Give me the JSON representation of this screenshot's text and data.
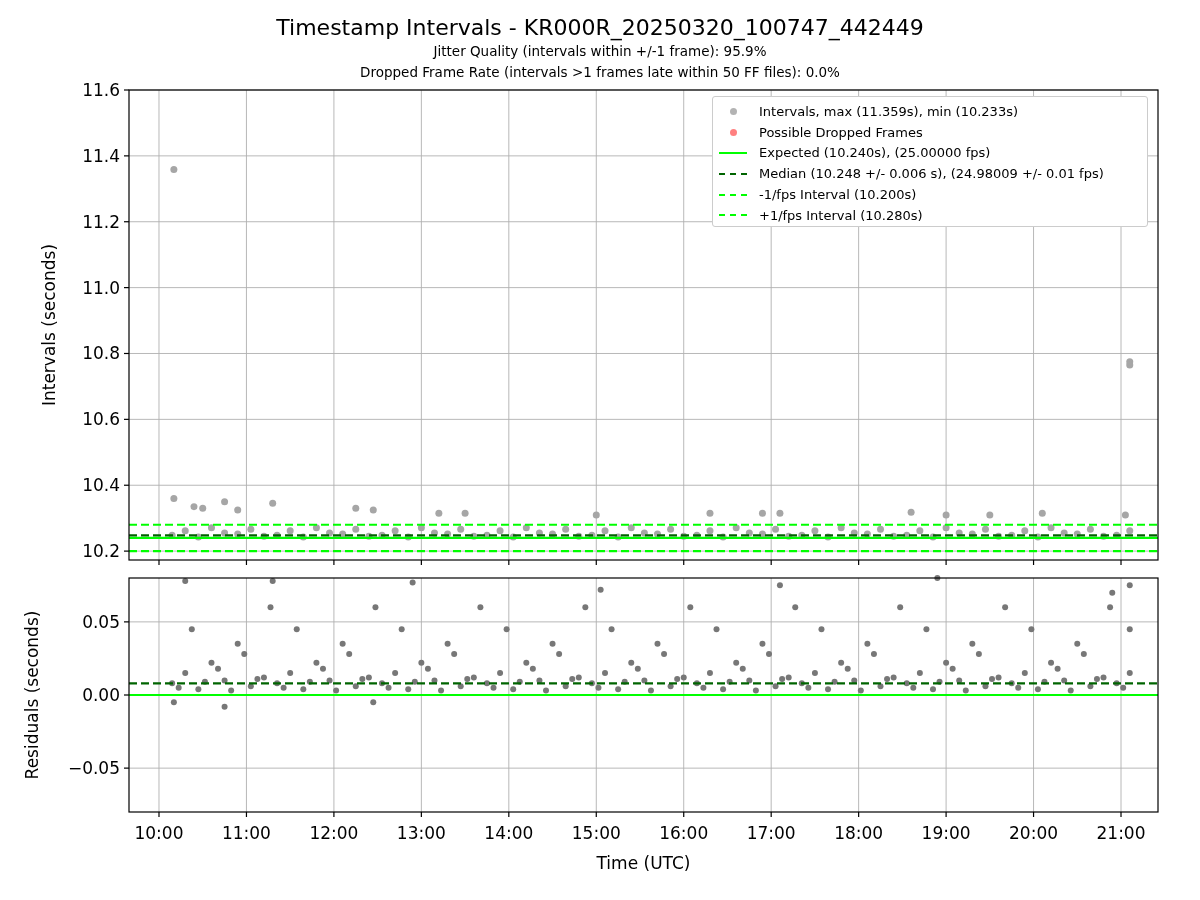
{
  "title": "Timestamp Intervals - KR000R_20250320_100747_442449",
  "subtitles": [
    "Jitter Quality (intervals within +/-1 frame): 95.9%",
    "Dropped Frame Rate (intervals >1 frames late within 50 FF files): 0.0%"
  ],
  "intervals_plot": {
    "legend": [
      {
        "label": "Intervals, max (11.359s), min (10.233s)",
        "kind": "point",
        "color": "#b3b3b3"
      },
      {
        "label": "Possible Dropped Frames",
        "kind": "point",
        "color": "#ff8080"
      },
      {
        "label": "Expected (10.240s), (25.00000 fps)",
        "kind": "solid",
        "color": "#00ff00"
      },
      {
        "label": "Median (10.248 +/- 0.006 s), (24.98009 +/- 0.01 fps)",
        "kind": "dashed",
        "color": "#006400"
      },
      {
        "label": "-1/fps Interval (10.200s)",
        "kind": "dashed",
        "color": "#00ff00"
      },
      {
        "label": "+1/fps Interval (10.280s)",
        "kind": "dashed",
        "color": "#00ff00"
      }
    ],
    "chart_data": {
      "type": "scatter",
      "ylabel": "Intervals (seconds)",
      "xlim": [
        9.657,
        21.423
      ],
      "ylim": [
        10.173,
        11.6
      ],
      "yticks": [
        {
          "value": 10.2,
          "label": "10.2"
        },
        {
          "value": 10.4,
          "label": "10.4"
        },
        {
          "value": 10.6,
          "label": "10.6"
        },
        {
          "value": 10.8,
          "label": "10.8"
        },
        {
          "value": 11.0,
          "label": "11.0"
        },
        {
          "value": 11.2,
          "label": "11.2"
        },
        {
          "value": 11.4,
          "label": "11.4"
        },
        {
          "value": 11.6,
          "label": "11.6"
        }
      ],
      "series": [
        {
          "color": "#a6a6a6",
          "x": [
            10.15,
            10.3,
            10.45,
            10.6,
            10.75,
            10.9,
            11.05,
            11.2,
            11.35,
            11.5,
            11.65,
            11.8,
            11.95,
            12.1,
            12.25,
            12.4,
            12.55,
            12.7,
            12.85,
            13,
            13.15,
            13.3,
            13.45,
            13.6,
            13.75,
            13.9,
            14.05,
            14.2,
            14.35,
            14.5,
            14.65,
            14.8,
            14.95,
            15.1,
            15.25,
            15.4,
            15.55,
            15.7,
            15.85,
            16,
            16.15,
            16.3,
            16.45,
            16.6,
            16.75,
            16.9,
            17.05,
            17.2,
            17.35,
            17.5,
            17.65,
            17.8,
            17.95,
            18.1,
            18.25,
            18.4,
            18.55,
            18.7,
            18.85,
            19,
            19.15,
            19.3,
            19.45,
            19.6,
            19.75,
            19.9,
            20.05,
            20.2,
            20.35,
            20.5,
            20.65,
            20.8,
            20.95,
            21.1,
            10.17,
            10.17,
            21.1,
            21.1,
            10.75,
            11.3,
            10.4,
            10.5,
            10.9,
            12.25,
            12.45,
            13.2,
            13.5,
            15.0,
            16.3,
            16.9,
            17.1,
            18.6,
            19.0,
            19.5,
            20.1,
            21.05
          ],
          "values": [
            10.248,
            10.262,
            10.243,
            10.271,
            10.255,
            10.252,
            10.266,
            10.245,
            10.248,
            10.262,
            10.243,
            10.271,
            10.255,
            10.252,
            10.266,
            10.245,
            10.248,
            10.262,
            10.243,
            10.271,
            10.255,
            10.252,
            10.266,
            10.245,
            10.248,
            10.262,
            10.243,
            10.271,
            10.255,
            10.252,
            10.266,
            10.245,
            10.248,
            10.262,
            10.243,
            10.271,
            10.255,
            10.252,
            10.266,
            10.245,
            10.248,
            10.262,
            10.243,
            10.271,
            10.255,
            10.252,
            10.266,
            10.245,
            10.248,
            10.262,
            10.243,
            10.271,
            10.255,
            10.252,
            10.266,
            10.245,
            10.248,
            10.262,
            10.243,
            10.271,
            10.255,
            10.252,
            10.266,
            10.245,
            10.248,
            10.262,
            10.243,
            10.271,
            10.255,
            10.252,
            10.266,
            10.245,
            10.248,
            10.262,
            11.359,
            10.36,
            10.775,
            10.765,
            10.35,
            10.345,
            10.335,
            10.33,
            10.325,
            10.33,
            10.325,
            10.315,
            10.315,
            10.31,
            10.315,
            10.315,
            10.315,
            10.318,
            10.31,
            10.31,
            10.315,
            10.31
          ]
        }
      ],
      "ref_lines": [
        {
          "axis": "y",
          "value": 10.24,
          "color": "#00ff00"
        },
        {
          "axis": "y",
          "value": 10.248,
          "color": "#006400"
        },
        {
          "axis": "y",
          "value": 10.2,
          "color": "#00ff00"
        },
        {
          "axis": "y",
          "value": 10.28,
          "color": "#00ff00"
        }
      ],
      "grid": true
    }
  },
  "residuals_plot": {
    "chart_data": {
      "type": "scatter",
      "xlabel": "Time (UTC)",
      "ylabel": "Residuals (seconds)",
      "xlim": [
        9.657,
        21.423
      ],
      "ylim": [
        -0.08,
        0.08
      ],
      "xticks": [
        {
          "value": 10,
          "label": "10:00"
        },
        {
          "value": 11,
          "label": "11:00"
        },
        {
          "value": 12,
          "label": "12:00"
        },
        {
          "value": 13,
          "label": "13:00"
        },
        {
          "value": 14,
          "label": "14:00"
        },
        {
          "value": 15,
          "label": "15:00"
        },
        {
          "value": 16,
          "label": "16:00"
        },
        {
          "value": 17,
          "label": "17:00"
        },
        {
          "value": 18,
          "label": "18:00"
        },
        {
          "value": 19,
          "label": "19:00"
        },
        {
          "value": 20,
          "label": "20:00"
        },
        {
          "value": 21,
          "label": "21:00"
        }
      ],
      "yticks": [
        {
          "value": -0.05,
          "label": "−0.05"
        },
        {
          "value": 0,
          "label": "0.00"
        },
        {
          "value": 0.05,
          "label": "0.05"
        }
      ],
      "series": [
        {
          "color": "#777777",
          "x": [
            10.15,
            10.3,
            10.45,
            10.6,
            10.75,
            10.9,
            11.05,
            11.2,
            11.35,
            11.5,
            11.65,
            11.8,
            11.95,
            12.1,
            12.25,
            12.4,
            12.55,
            12.7,
            12.85,
            13,
            13.15,
            13.3,
            13.45,
            13.6,
            13.75,
            13.9,
            14.05,
            14.2,
            14.35,
            14.5,
            14.65,
            14.8,
            14.95,
            15.1,
            15.25,
            15.4,
            15.55,
            15.7,
            15.85,
            16,
            16.15,
            16.3,
            16.45,
            16.6,
            16.75,
            16.9,
            17.05,
            17.2,
            17.35,
            17.5,
            17.65,
            17.8,
            17.95,
            18.1,
            18.25,
            18.4,
            18.55,
            18.7,
            18.85,
            19,
            19.15,
            19.3,
            19.45,
            19.6,
            19.75,
            19.9,
            20.05,
            20.2,
            20.35,
            20.5,
            20.65,
            20.8,
            20.95,
            21.1,
            10.225,
            10.375,
            10.525,
            10.675,
            10.825,
            10.975,
            11.125,
            11.275,
            11.425,
            11.575,
            11.725,
            11.875,
            12.025,
            12.175,
            12.325,
            12.475,
            12.625,
            12.775,
            12.925,
            13.075,
            13.225,
            13.375,
            13.525,
            13.675,
            13.825,
            13.975,
            14.125,
            14.275,
            14.425,
            14.575,
            14.725,
            14.875,
            15.025,
            15.175,
            15.325,
            15.475,
            15.625,
            15.775,
            15.925,
            16.075,
            16.225,
            16.375,
            16.525,
            16.675,
            16.825,
            16.975,
            17.125,
            17.275,
            17.425,
            17.575,
            17.725,
            17.875,
            18.025,
            18.175,
            18.325,
            18.475,
            18.625,
            18.775,
            18.925,
            19.075,
            19.225,
            19.375,
            19.525,
            19.675,
            19.825,
            19.975,
            20.125,
            20.275,
            20.425,
            20.575,
            20.725,
            20.875,
            21.025,
            21.1,
            10.17,
            10.75,
            12.45,
            10.3,
            11.3,
            12.9,
            15.05,
            17.1,
            18.9,
            21.1,
            20.9
          ],
          "values": [
            0.008,
            0.015,
            0.004,
            0.022,
            0.01,
            0.035,
            0.006,
            0.012,
            0.008,
            0.015,
            0.004,
            0.022,
            0.01,
            0.035,
            0.006,
            0.012,
            0.008,
            0.015,
            0.004,
            0.022,
            0.01,
            0.035,
            0.006,
            0.012,
            0.008,
            0.015,
            0.004,
            0.022,
            0.01,
            0.035,
            0.006,
            0.012,
            0.008,
            0.015,
            0.004,
            0.022,
            0.01,
            0.035,
            0.006,
            0.012,
            0.008,
            0.015,
            0.004,
            0.022,
            0.01,
            0.035,
            0.006,
            0.012,
            0.008,
            0.015,
            0.004,
            0.022,
            0.01,
            0.035,
            0.006,
            0.012,
            0.008,
            0.015,
            0.004,
            0.022,
            0.01,
            0.035,
            0.006,
            0.012,
            0.008,
            0.015,
            0.004,
            0.022,
            0.01,
            0.035,
            0.006,
            0.012,
            0.008,
            0.015,
            0.005,
            0.045,
            0.009,
            0.018,
            0.003,
            0.028,
            0.011,
            0.06,
            0.005,
            0.045,
            0.009,
            0.018,
            0.003,
            0.028,
            0.011,
            0.06,
            0.005,
            0.045,
            0.009,
            0.018,
            0.003,
            0.028,
            0.011,
            0.06,
            0.005,
            0.045,
            0.009,
            0.018,
            0.003,
            0.028,
            0.011,
            0.06,
            0.005,
            0.045,
            0.009,
            0.018,
            0.003,
            0.028,
            0.011,
            0.06,
            0.005,
            0.045,
            0.009,
            0.018,
            0.003,
            0.028,
            0.011,
            0.06,
            0.005,
            0.045,
            0.009,
            0.018,
            0.003,
            0.028,
            0.011,
            0.06,
            0.005,
            0.045,
            0.009,
            0.018,
            0.003,
            0.028,
            0.011,
            0.06,
            0.005,
            0.045,
            0.009,
            0.018,
            0.003,
            0.028,
            0.011,
            0.06,
            0.005,
            0.045,
            -0.005,
            -0.008,
            -0.005,
            0.078,
            0.078,
            0.077,
            0.072,
            0.075,
            0.08,
            0.075,
            0.07
          ]
        }
      ],
      "ref_lines": [
        {
          "axis": "y",
          "value": 0.008,
          "color": "#006400"
        },
        {
          "axis": "y",
          "value": 0,
          "color": "#00ff00"
        }
      ],
      "grid": true
    }
  }
}
